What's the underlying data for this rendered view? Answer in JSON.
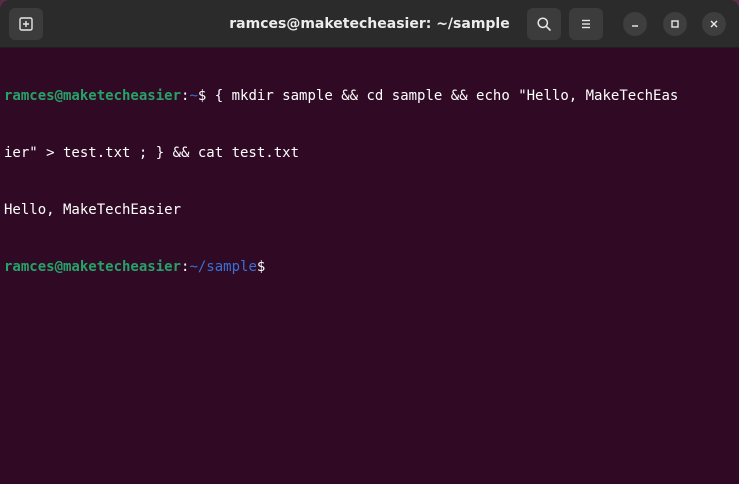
{
  "window": {
    "title": "ramces@maketecheasier: ~/sample"
  },
  "titlebar": {
    "icons": {
      "new_tab": "new-tab-icon",
      "search": "search-icon",
      "menu": "hamburger-menu-icon",
      "minimize": "minimize-icon",
      "maximize": "maximize-icon",
      "close": "close-icon"
    }
  },
  "terminal": {
    "colors": {
      "background": "#300a24",
      "user_host": "#26a269",
      "path": "#3a6fd6",
      "text": "#ffffff"
    },
    "lines": [
      {
        "user_host": "ramces@maketecheasier",
        "colon": ":",
        "path": "~",
        "prompt": "$",
        "command": " { mkdir sample && cd sample && echo \"Hello, MakeTechEas"
      },
      {
        "text": "ier\" > test.txt ; } && cat test.txt"
      },
      {
        "text": "Hello, MakeTechEasier"
      },
      {
        "user_host": "ramces@maketecheasier",
        "colon": ":",
        "path": "~/sample",
        "prompt": "$"
      }
    ]
  }
}
